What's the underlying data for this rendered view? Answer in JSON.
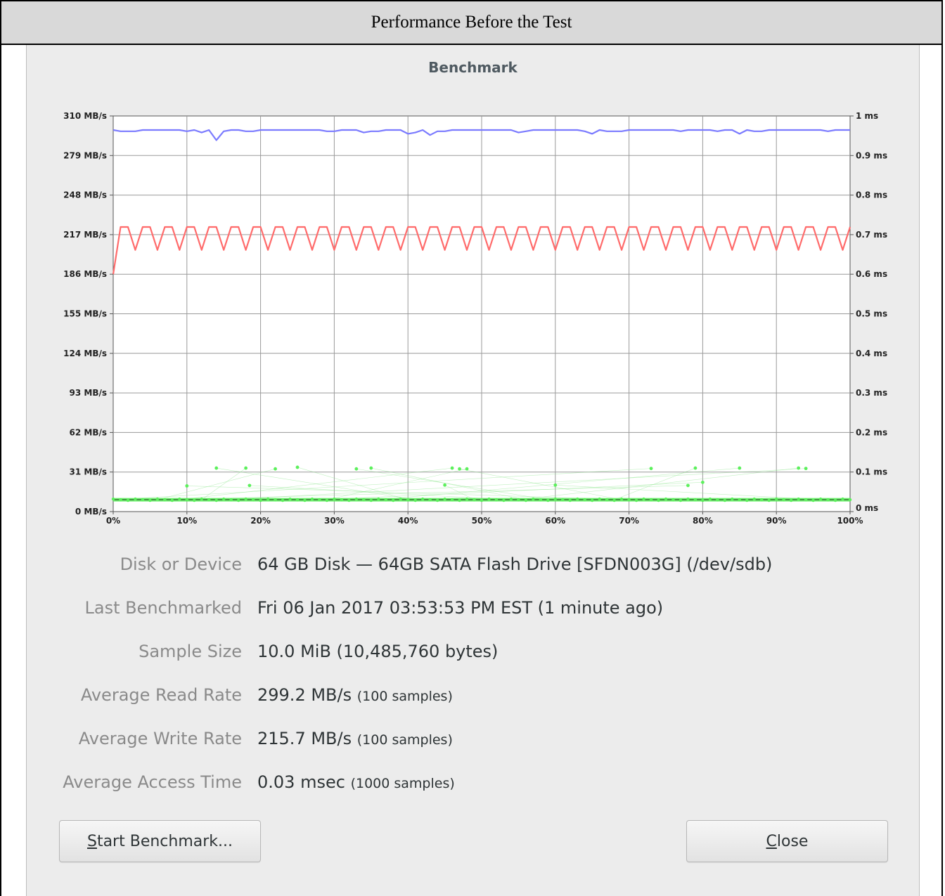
{
  "caption": "Performance Before the Test",
  "dialog": {
    "title": "Benchmark",
    "info": [
      {
        "label": "Disk or Device",
        "value": "64 GB Disk — 64GB SATA Flash Drive [SFDN003G] (/dev/sdb)",
        "detail": ""
      },
      {
        "label": "Last Benchmarked",
        "value": "Fri 06 Jan 2017 03:53:53 PM EST (1 minute ago)",
        "detail": ""
      },
      {
        "label": "Sample Size",
        "value": "10.0 MiB (10,485,760 bytes)",
        "detail": ""
      },
      {
        "label": "Average Read Rate",
        "value": "299.2 MB/s",
        "detail": "(100 samples)"
      },
      {
        "label": "Average Write Rate",
        "value": "215.7 MB/s",
        "detail": "(100 samples)"
      },
      {
        "label": "Average Access Time",
        "value": "0.03 msec",
        "detail": "(1000 samples)"
      }
    ],
    "buttons": {
      "start": {
        "mnemonic": "S",
        "rest": "tart Benchmark..."
      },
      "close": {
        "mnemonic": "C",
        "rest": "lose"
      }
    }
  },
  "chart_data": {
    "type": "line",
    "title": "",
    "left_axis": {
      "labels": [
        "310 MB/s",
        "279 MB/s",
        "248 MB/s",
        "217 MB/s",
        "186 MB/s",
        "155 MB/s",
        "124 MB/s",
        "93 MB/s",
        "62 MB/s",
        "31 MB/s",
        "0 MB/s"
      ],
      "range": [
        0,
        310
      ]
    },
    "right_axis": {
      "labels": [
        "1 ms",
        "0.9 ms",
        "0.8 ms",
        "0.7 ms",
        "0.6 ms",
        "0.5 ms",
        "0.4 ms",
        "0.3 ms",
        "0.2 ms",
        "0.1 ms",
        "0 ms"
      ],
      "range": [
        0,
        1
      ]
    },
    "x_axis": {
      "labels": [
        "0%",
        "10%",
        "20%",
        "30%",
        "40%",
        "50%",
        "60%",
        "70%",
        "80%",
        "90%",
        "100%"
      ],
      "range": [
        0,
        100
      ]
    },
    "grid": true,
    "series": [
      {
        "role": "read",
        "color": "#7b7bff",
        "values": [
          299,
          298,
          298,
          298,
          299,
          299,
          299,
          299,
          299,
          299,
          298,
          299,
          297,
          299,
          291,
          298,
          299,
          299,
          298,
          298,
          299,
          299,
          299,
          299,
          299,
          299,
          299,
          299,
          299,
          298,
          298,
          299,
          299,
          299,
          297,
          298,
          298,
          299,
          299,
          299,
          296,
          297,
          299,
          295,
          298,
          298,
          299,
          299,
          299,
          299,
          299,
          299,
          299,
          299,
          299,
          297,
          298,
          299,
          299,
          299,
          299,
          299,
          299,
          299,
          298,
          296,
          299,
          298,
          298,
          298,
          299,
          299,
          299,
          299,
          299,
          299,
          299,
          298,
          299,
          299,
          299,
          299,
          298,
          299,
          299,
          296,
          299,
          298,
          298,
          299,
          299,
          299,
          299,
          299,
          299,
          299,
          299,
          298,
          299,
          299,
          299
        ]
      },
      {
        "role": "write",
        "color": "#ff6b6b",
        "values": [
          186,
          223,
          223,
          205,
          223,
          223,
          205,
          223,
          223,
          205,
          223,
          223,
          205,
          223,
          223,
          205,
          223,
          223,
          205,
          223,
          223,
          205,
          223,
          223,
          205,
          223,
          223,
          205,
          223,
          223,
          205,
          223,
          223,
          205,
          223,
          223,
          205,
          223,
          223,
          205,
          223,
          223,
          205,
          223,
          223,
          205,
          223,
          223,
          205,
          223,
          223,
          205,
          223,
          223,
          205,
          223,
          223,
          205,
          223,
          223,
          205,
          223,
          223,
          205,
          223,
          223,
          205,
          223,
          223,
          205,
          223,
          223,
          205,
          223,
          223,
          205,
          223,
          223,
          205,
          223,
          223,
          205,
          223,
          223,
          205,
          223,
          223,
          205,
          223,
          223,
          205,
          223,
          223,
          205,
          223,
          223,
          205,
          223,
          223,
          205,
          223
        ]
      },
      {
        "role": "access-time",
        "color": "#5cf05c",
        "baseline_ms": 0.03,
        "outliers": [
          {
            "x": 10,
            "y": 0.065
          },
          {
            "x": 14,
            "y": 0.11
          },
          {
            "x": 18,
            "y": 0.11
          },
          {
            "x": 18.5,
            "y": 0.066
          },
          {
            "x": 22,
            "y": 0.108
          },
          {
            "x": 25,
            "y": 0.112
          },
          {
            "x": 33,
            "y": 0.108
          },
          {
            "x": 35,
            "y": 0.11
          },
          {
            "x": 45,
            "y": 0.067
          },
          {
            "x": 46,
            "y": 0.11
          },
          {
            "x": 47,
            "y": 0.108
          },
          {
            "x": 48,
            "y": 0.108
          },
          {
            "x": 60,
            "y": 0.067
          },
          {
            "x": 73,
            "y": 0.109
          },
          {
            "x": 78,
            "y": 0.066
          },
          {
            "x": 79,
            "y": 0.11
          },
          {
            "x": 80,
            "y": 0.074
          },
          {
            "x": 85,
            "y": 0.11
          },
          {
            "x": 93,
            "y": 0.11
          },
          {
            "x": 94,
            "y": 0.109
          }
        ]
      }
    ]
  }
}
